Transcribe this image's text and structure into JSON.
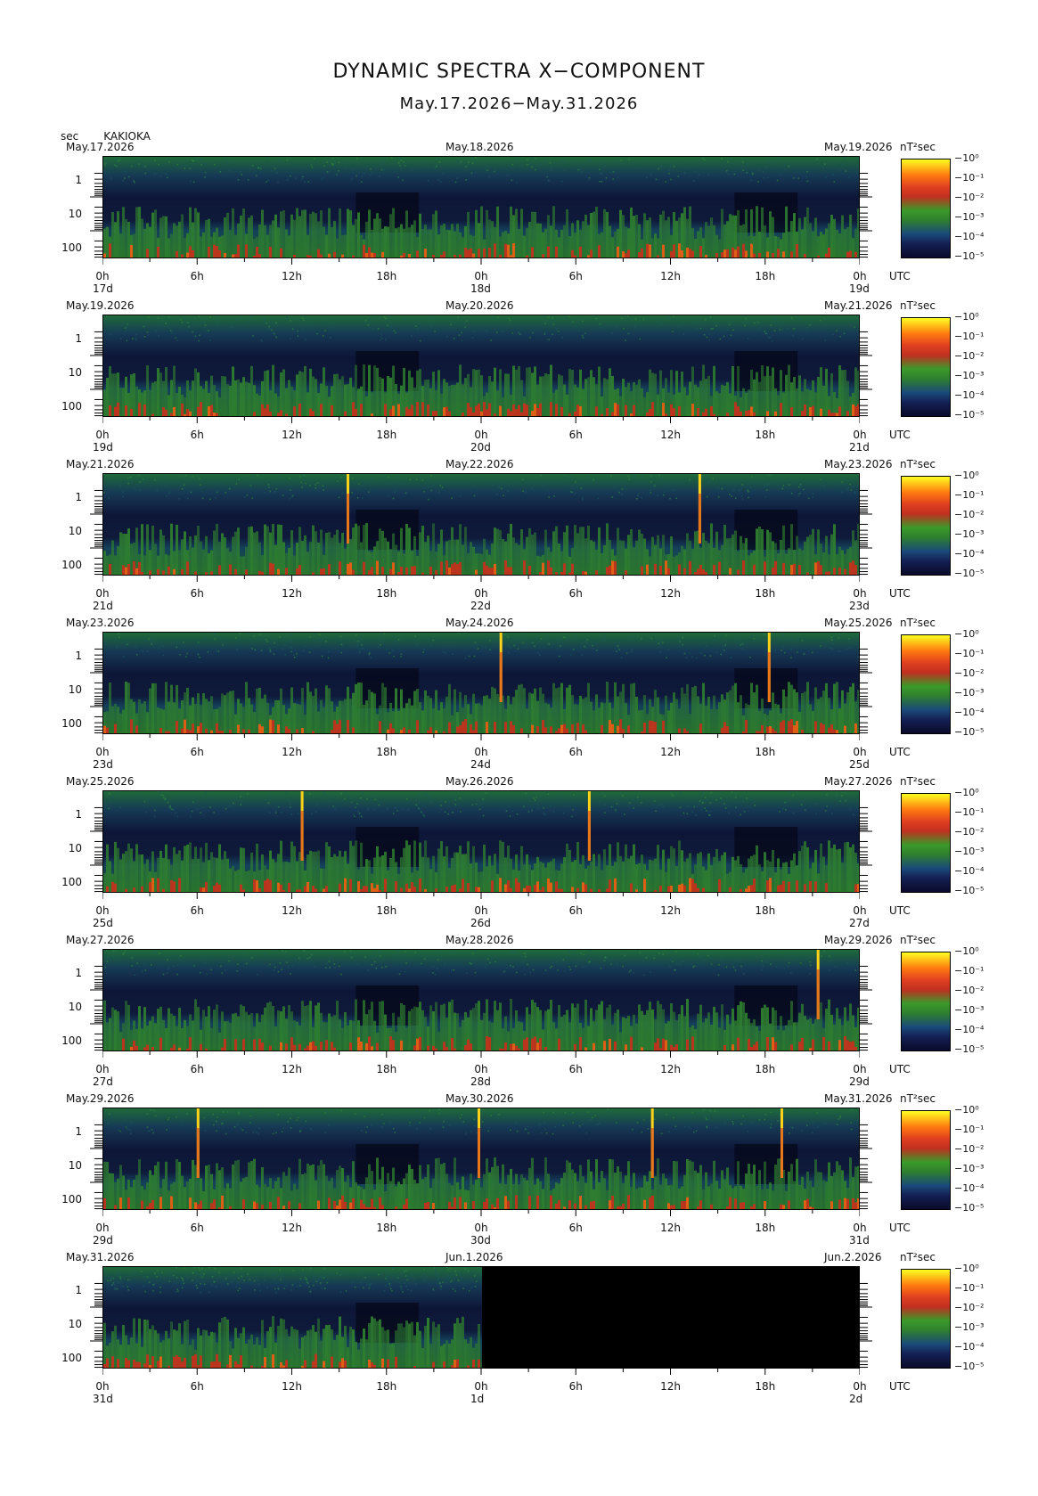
{
  "title": "DYNAMIC SPECTRA X−COMPONENT",
  "subtitle": "May.17.2026−May.31.2026",
  "y_axis_unit": "sec",
  "station": "KAKIOKA",
  "colorbar_unit": "nT²sec",
  "colorbar_labels": [
    "10⁰",
    "10⁻¹",
    "10⁻²",
    "10⁻³",
    "10⁻⁴",
    "10⁻⁵"
  ],
  "y_tick_labels": [
    "1",
    "10",
    "100"
  ],
  "x_tick_labels": [
    "0h",
    "6h",
    "12h",
    "18h",
    "0h",
    "6h",
    "12h",
    "18h",
    "0h"
  ],
  "x_axis_tz": "UTC",
  "colors": {
    "background": "#ffffff",
    "plot_low": "#10163a",
    "plot_green": "#2f7f2f",
    "plot_red": "#d42a1a",
    "spike": "#ffd21a"
  },
  "chart_data": [
    {
      "type": "heatmap",
      "start_label": "May.17.2026",
      "mid_label": "May.18.2026",
      "end_label": "May.19.2026",
      "day_start": "17d",
      "day_mid": "18d",
      "day_end": "19d",
      "spikes_hours": [],
      "data_until_hour": 48
    },
    {
      "type": "heatmap",
      "start_label": "May.19.2026",
      "mid_label": "May.20.2026",
      "end_label": "May.21.2026",
      "day_start": "19d",
      "day_mid": "20d",
      "day_end": "21d",
      "spikes_hours": [],
      "data_until_hour": 48
    },
    {
      "type": "heatmap",
      "start_label": "May.21.2026",
      "mid_label": "May.22.2026",
      "end_label": "May.23.2026",
      "day_start": "21d",
      "day_mid": "22d",
      "day_end": "23d",
      "spikes_hours": [
        15.5,
        37.8
      ],
      "data_until_hour": 48
    },
    {
      "type": "heatmap",
      "start_label": "May.23.2026",
      "mid_label": "May.24.2026",
      "end_label": "May.25.2026",
      "day_start": "23d",
      "day_mid": "24d",
      "day_end": "25d",
      "spikes_hours": [
        25.2,
        42.2
      ],
      "data_until_hour": 48
    },
    {
      "type": "heatmap",
      "start_label": "May.25.2026",
      "mid_label": "May.26.2026",
      "end_label": "May.27.2026",
      "day_start": "25d",
      "day_mid": "26d",
      "day_end": "27d",
      "spikes_hours": [
        12.6,
        30.8
      ],
      "data_until_hour": 48
    },
    {
      "type": "heatmap",
      "start_label": "May.27.2026",
      "mid_label": "May.28.2026",
      "end_label": "May.29.2026",
      "day_start": "27d",
      "day_mid": "28d",
      "day_end": "29d",
      "spikes_hours": [
        45.3
      ],
      "data_until_hour": 48
    },
    {
      "type": "heatmap",
      "start_label": "May.29.2026",
      "mid_label": "May.30.2026",
      "end_label": "May.31.2026",
      "day_start": "29d",
      "day_mid": "30d",
      "day_end": "31d",
      "spikes_hours": [
        6.0,
        23.8,
        34.8,
        43.0
      ],
      "data_until_hour": 48
    },
    {
      "type": "heatmap",
      "start_label": "May.31.2026",
      "mid_label": "Jun.1.2026",
      "end_label": "Jun.2.2026",
      "day_start": "31d",
      "day_mid": "1d",
      "day_end": "2d",
      "spikes_hours": [],
      "data_until_hour": 24
    }
  ]
}
